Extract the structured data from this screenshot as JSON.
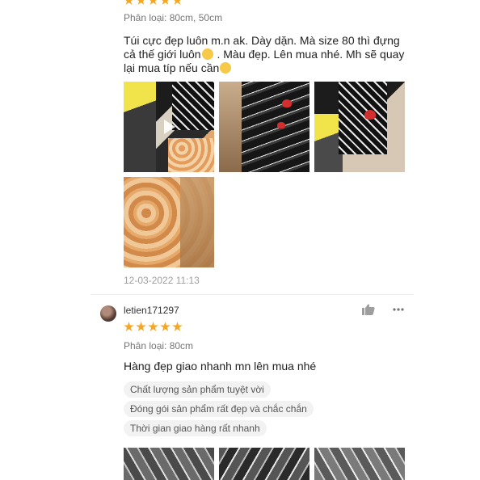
{
  "review1": {
    "variant": "Phân loại: 80cm, 50cm",
    "text_parts": [
      "Túi cực đẹp luôn m.n ak. Dày dặn. Mà size 80 thì đựng cả thế giới luôn",
      " . Màu đẹp. Lên mua nhé. Mh sẽ quay lại mua típ nếu cần"
    ],
    "date": "12-03-2022 11:13"
  },
  "review2": {
    "username": "letien171297",
    "rating": 5,
    "variant": "Phân loại: 80cm",
    "text": "Hàng đẹp giao nhanh mn lên mua nhé",
    "tags": [
      "Chất lượng sản phẩm tuyệt vời",
      "Đóng gói sản phẩm rất đẹp và chắc chắn",
      "Thời gian giao hàng rất nhanh"
    ]
  },
  "colors": {
    "star": "#f5a623",
    "tag_bg": "#f2f2f2"
  },
  "icons": {
    "like": "thumbs-up-icon",
    "more": "more-dots-icon"
  }
}
